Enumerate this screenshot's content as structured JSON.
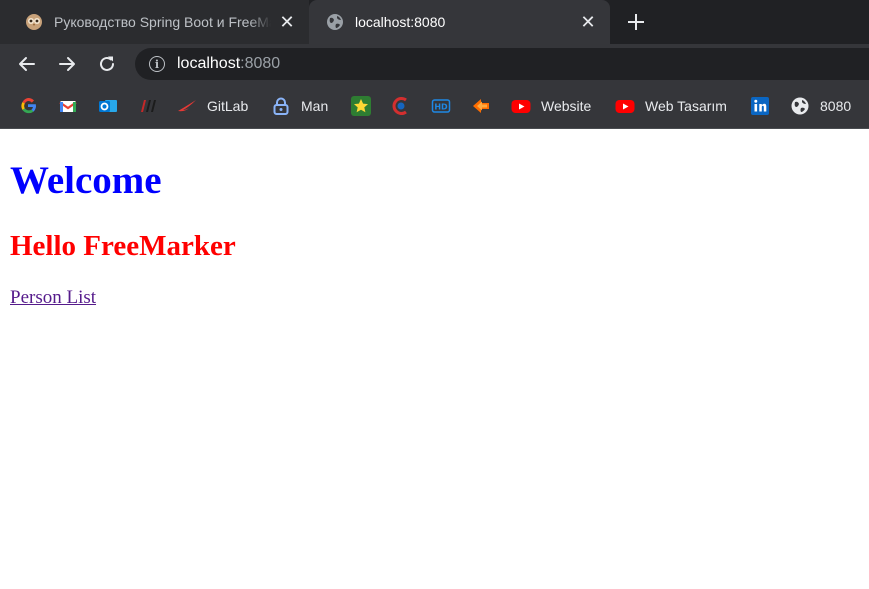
{
  "browser": {
    "tabs": [
      {
        "title": "Руководство Spring Boot и FreeMarker",
        "favicon": "owl-favicon-icon",
        "active": false
      },
      {
        "title": "localhost:8080",
        "favicon": "globe-icon",
        "active": true
      }
    ],
    "address": {
      "host": "localhost",
      "port": ":8080"
    },
    "bookmarks": [
      {
        "label": "",
        "icon": "google-icon"
      },
      {
        "label": "",
        "icon": "gmail-icon"
      },
      {
        "label": "",
        "icon": "outlook-icon"
      },
      {
        "label": "",
        "icon": "dark-logo-icon"
      },
      {
        "label": "GitLab",
        "icon": "red-swoosh-icon"
      },
      {
        "label": "Man",
        "icon": "lock-icon"
      },
      {
        "label": "",
        "icon": "star-icon"
      },
      {
        "label": "",
        "icon": "red-arc-icon"
      },
      {
        "label": "",
        "icon": "hd-icon"
      },
      {
        "label": "",
        "icon": "orange-arrow-icon"
      },
      {
        "label": "Website",
        "icon": "youtube-icon"
      },
      {
        "label": "Web Tasarım",
        "icon": "youtube-icon"
      },
      {
        "label": "",
        "icon": "linkedin-icon"
      },
      {
        "label": "8080",
        "icon": "globe-icon"
      }
    ]
  },
  "page": {
    "heading": "Welcome",
    "subheading": "Hello FreeMarker",
    "link": "Person List"
  },
  "colors": {
    "heading": "#0000ff",
    "subheading": "#ff0000",
    "visited_link": "#551a8b",
    "chrome_dark": "#35363a"
  }
}
